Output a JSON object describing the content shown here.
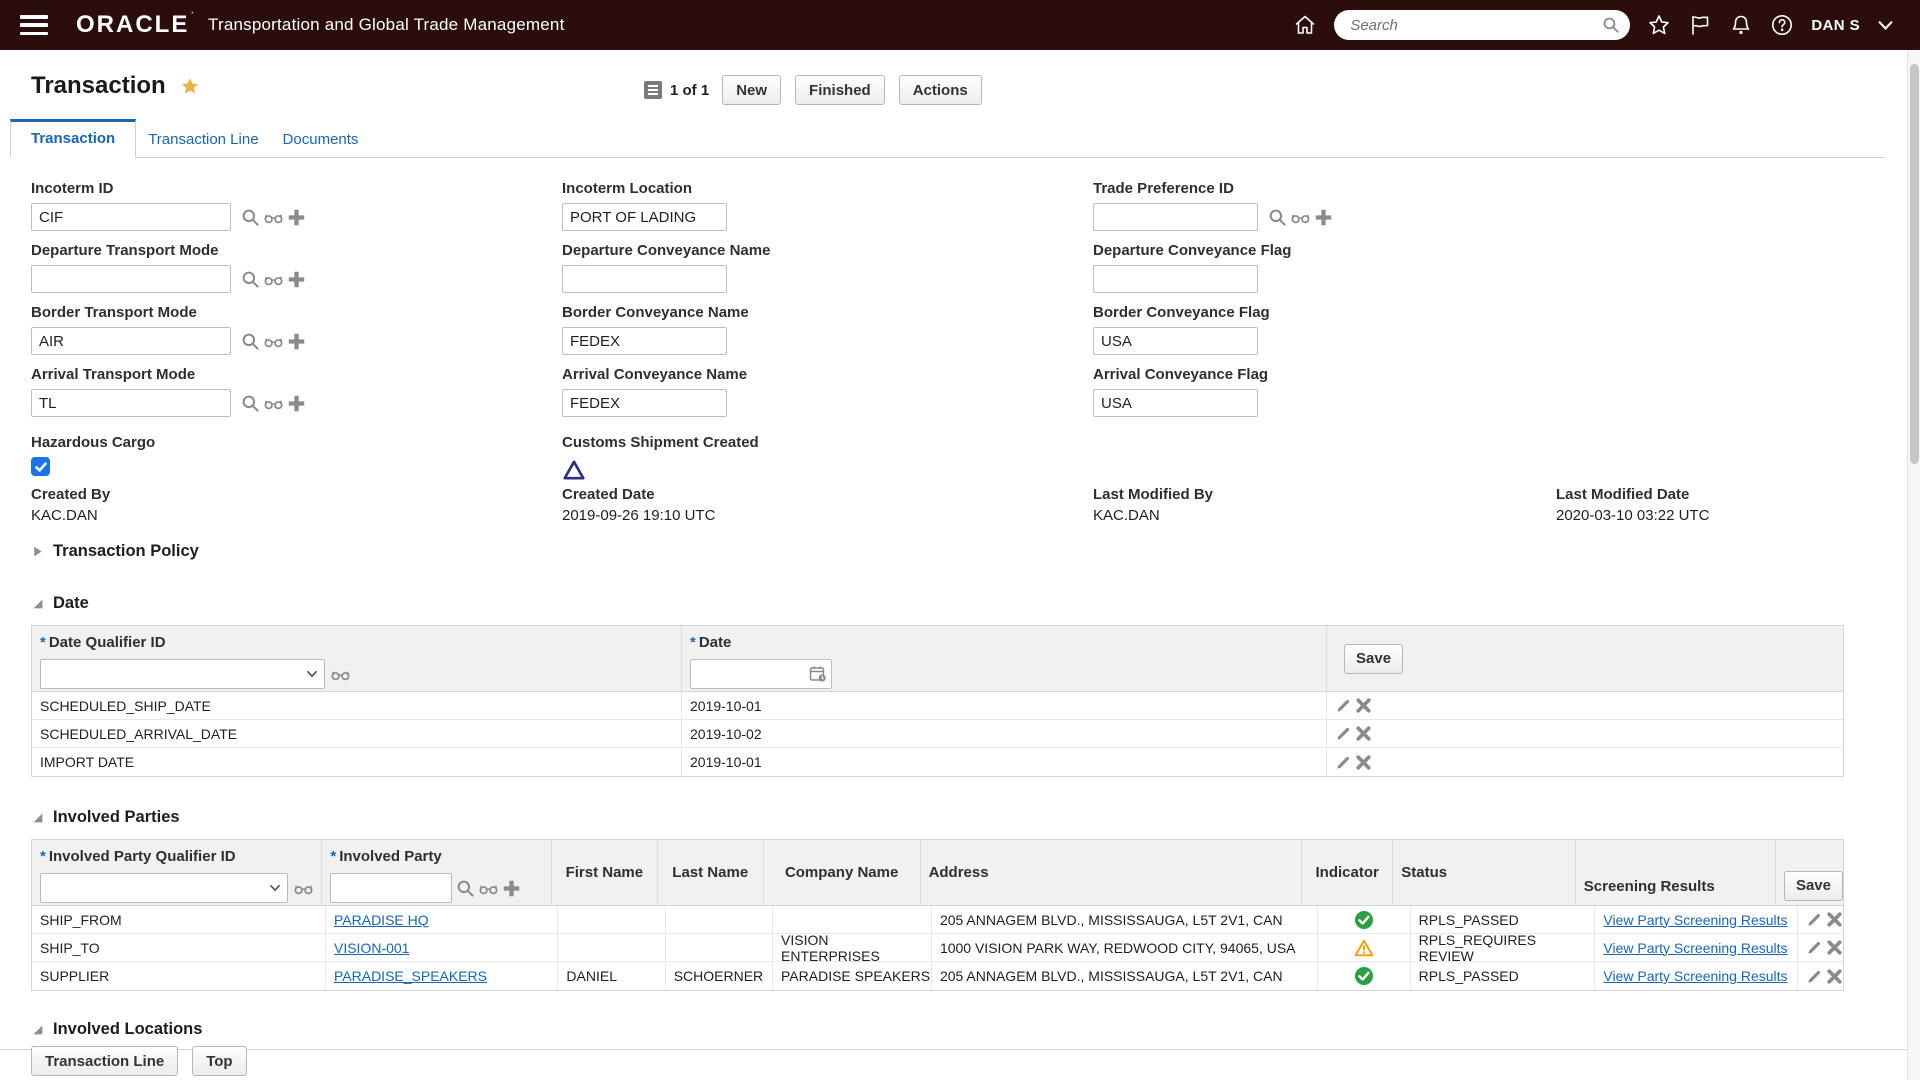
{
  "ui": {
    "required_marker": "*"
  },
  "colors": {
    "accent": "#1767b3",
    "header_bg": "#2b0d0c",
    "pass_green": "#2e9e44",
    "warn_orange": "#f0a30a",
    "checkbox_blue": "#1a73e8"
  },
  "header": {
    "brand": "ORACLE",
    "app_title": "Transportation and Global Trade Management",
    "search_placeholder": "Search",
    "user_name": "DAN S"
  },
  "toolbar": {
    "record_count": "1 of 1",
    "new_label": "New",
    "finished_label": "Finished",
    "actions_label": "Actions"
  },
  "page": {
    "title": "Transaction"
  },
  "tabs": [
    {
      "label": "Transaction"
    },
    {
      "label": "Transaction Line"
    },
    {
      "label": "Documents"
    }
  ],
  "form": {
    "fields": [
      {
        "label": "Incoterm ID",
        "value": "CIF"
      },
      {
        "label": "Incoterm Location",
        "value": "PORT OF LADING"
      },
      {
        "label": "Trade Preference ID",
        "value": ""
      },
      {
        "label": "Departure Transport Mode",
        "value": ""
      },
      {
        "label": "Departure Conveyance Name",
        "value": ""
      },
      {
        "label": "Departure Conveyance Flag",
        "value": ""
      },
      {
        "label": "Border Transport Mode",
        "value": "AIR"
      },
      {
        "label": "Border Conveyance Name",
        "value": "FEDEX"
      },
      {
        "label": "Border Conveyance Flag",
        "value": "USA"
      },
      {
        "label": "Arrival Transport Mode",
        "value": "TL"
      },
      {
        "label": "Arrival Conveyance Name",
        "value": "FEDEX"
      },
      {
        "label": "Arrival Conveyance Flag",
        "value": "USA"
      }
    ],
    "hazardous_cargo_label": "Hazardous Cargo",
    "customs_shipment_label": "Customs Shipment Created",
    "created_by_label": "Created By",
    "created_by": "KAC.DAN",
    "created_date_label": "Created Date",
    "created_date": "2019-09-26 19:10 UTC",
    "last_modified_by_label": "Last Modified By",
    "last_modified_by": "KAC.DAN",
    "last_modified_date_label": "Last Modified Date",
    "last_modified_date": "2020-03-10 03:22 UTC"
  },
  "sections": {
    "transaction_policy": "Transaction Policy",
    "date": "Date",
    "involved_parties": "Involved Parties",
    "involved_locations": "Involved Locations"
  },
  "date_table": {
    "col_qualifier": "Date Qualifier ID",
    "col_date": "Date",
    "save_label": "Save",
    "rows": [
      {
        "qualifier": "SCHEDULED_SHIP_DATE",
        "date": "2019-10-01"
      },
      {
        "qualifier": "SCHEDULED_ARRIVAL_DATE",
        "date": "2019-10-02"
      },
      {
        "qualifier": "IMPORT DATE",
        "date": "2019-10-01"
      }
    ]
  },
  "parties_table": {
    "col_qualifier": "Involved Party Qualifier ID",
    "col_party": "Involved Party",
    "col_first": "First Name",
    "col_last": "Last Name",
    "col_company": "Company Name",
    "col_address": "Address",
    "col_indicator": "Indicator",
    "col_status": "Status",
    "col_screening": "Screening Results",
    "save_label": "Save",
    "rows": [
      {
        "qualifier": "SHIP_FROM",
        "party": "PARADISE HQ",
        "first_name": "",
        "last_name": "",
        "company": "",
        "address": "205 ANNAGEM BLVD., MISSISSAUGA, L5T 2V1, CAN",
        "indicator": "pass",
        "status": "RPLS_PASSED",
        "screening": "View Party Screening Results"
      },
      {
        "qualifier": "SHIP_TO",
        "party": "VISION-001",
        "first_name": "",
        "last_name": "",
        "company": "VISION ENTERPRISES",
        "address": "1000 VISION PARK WAY, REDWOOD CITY, 94065, USA",
        "indicator": "warning",
        "status": "RPLS_REQUIRES REVIEW",
        "screening": "View Party Screening Results"
      },
      {
        "qualifier": "SUPPLIER",
        "party": "PARADISE_SPEAKERS",
        "first_name": "DANIEL",
        "last_name": "SCHOERNER",
        "company": "PARADISE SPEAKERS",
        "address": "205 ANNAGEM BLVD., MISSISSAUGA, L5T 2V1, CAN",
        "indicator": "pass",
        "status": "RPLS_PASSED",
        "screening": "View Party Screening Results"
      }
    ]
  },
  "footer": {
    "transaction_line_label": "Transaction Line",
    "top_label": "Top"
  }
}
